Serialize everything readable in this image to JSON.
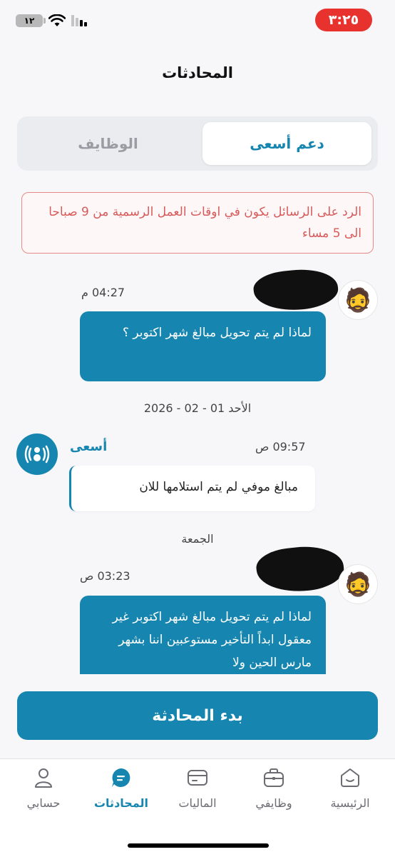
{
  "status_bar": {
    "time": "٣:٢٥",
    "battery": "١٢"
  },
  "header": {
    "title": "المحادثات"
  },
  "tabs": [
    {
      "label": "دعم أسعى",
      "active": true
    },
    {
      "label": "الوظايف",
      "active": false
    }
  ],
  "notice": {
    "text": "الرد على الرسائل يكون في اوقات العمل الرسمية من 9 صباحا الى 5 مساء"
  },
  "messages": [
    {
      "sender": "me",
      "time": "04:27 م",
      "text": "لماذا لم يتم تحويل مبالغ شهر اكتوبر ؟"
    },
    {
      "type": "date",
      "text": "الأحد 01 - 02 - 2026"
    },
    {
      "sender": "support",
      "name": "أسعى",
      "time": "09:57 ص",
      "text": "مبالغ موفي لم يتم استلامها للان"
    },
    {
      "type": "date",
      "text": "الجمعة"
    },
    {
      "sender": "me",
      "time": "03:23 ص",
      "text": "لماذا لم يتم تحويل مبالغ شهر اكتوبر غير معقول ابداً التأخير مستوعبين اننا بشهر مارس الحين ولا"
    }
  ],
  "actions": {
    "start_chat": "بدء المحادثة"
  },
  "bottom_nav": [
    {
      "label": "حسابي",
      "icon": "person-icon",
      "active": false
    },
    {
      "label": "المحادثات",
      "icon": "chat-icon",
      "active": true
    },
    {
      "label": "الماليات",
      "icon": "wallet-icon",
      "active": false
    },
    {
      "label": "وظايفي",
      "icon": "briefcase-icon",
      "active": false
    },
    {
      "label": "الرئيسية",
      "icon": "home-icon",
      "active": false
    }
  ],
  "colors": {
    "primary": "#1686b0",
    "danger": "#e8322e",
    "notice_text": "#d85a5a"
  }
}
